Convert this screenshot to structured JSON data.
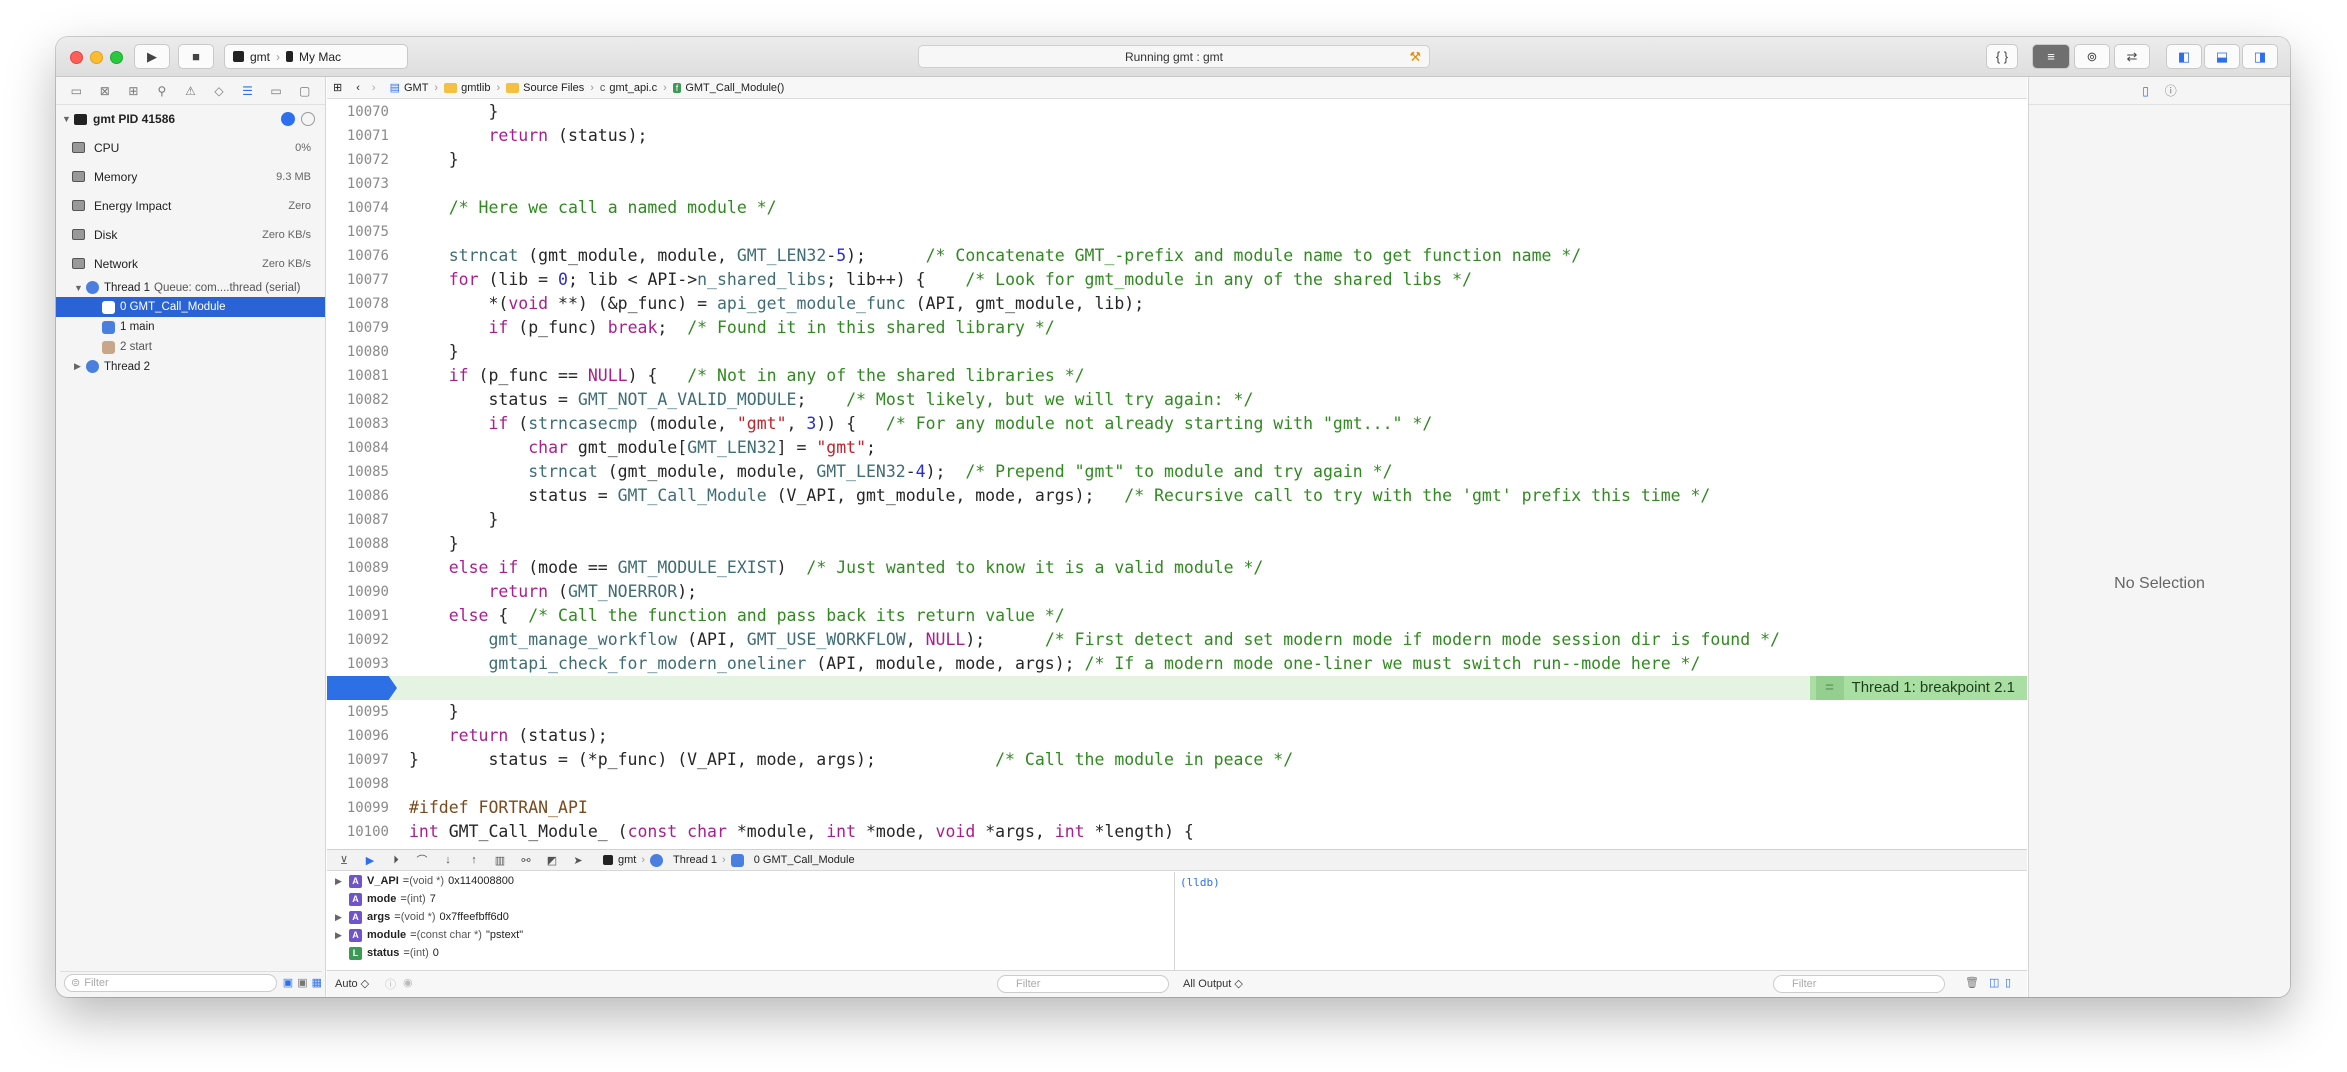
{
  "titlebar": {
    "scheme_target": "gmt",
    "scheme_device": "My Mac",
    "activity_status": "Running gmt : gmt"
  },
  "navigator": {
    "process_label": "gmt PID 41586",
    "gauges": [
      {
        "label": "CPU",
        "value": "0%"
      },
      {
        "label": "Memory",
        "value": "9.3 MB"
      },
      {
        "label": "Energy Impact",
        "value": "Zero"
      },
      {
        "label": "Disk",
        "value": "Zero KB/s"
      },
      {
        "label": "Network",
        "value": "Zero KB/s"
      }
    ],
    "thread1": "Thread 1",
    "thread1_queue": "Queue: com....thread (serial)",
    "frames": [
      "0 GMT_Call_Module",
      "1 main",
      "2 start"
    ],
    "thread2": "Thread 2",
    "filter_placeholder": "Filter"
  },
  "jumpbar": {
    "items": [
      "GMT",
      "gmtlib",
      "Source Files",
      "gmt_api.c",
      "GMT_Call_Module()"
    ]
  },
  "editor": {
    "breakpoint_label": "Thread 1: breakpoint 2.1",
    "current_line": 10094
  },
  "debugbar": {
    "crumbs": [
      "gmt",
      "Thread 1",
      "0 GMT_Call_Module"
    ]
  },
  "variables": [
    {
      "name": "V_API",
      "type": "(void *)",
      "value": "0x114008800",
      "expandable": true,
      "badge": "A"
    },
    {
      "name": "mode",
      "type": "(int)",
      "value": "7",
      "expandable": false,
      "badge": "A"
    },
    {
      "name": "args",
      "type": "(void *)",
      "value": "0x7ffeefbff6d0",
      "expandable": true,
      "badge": "A"
    },
    {
      "name": "module",
      "type": "(const char *)",
      "value": "\"pstext\"",
      "expandable": true,
      "badge": "A"
    },
    {
      "name": "status",
      "type": "(int)",
      "value": "0",
      "expandable": false,
      "badge": "L"
    }
  ],
  "console": {
    "prompt": "(lldb)"
  },
  "bottombar": {
    "auto_label": "Auto ◇",
    "filter_placeholder": "Filter",
    "output_label": "All Output ◇",
    "console_filter_placeholder": "Filter"
  },
  "inspector": {
    "empty_label": "No Selection"
  },
  "colors": {
    "accent": "#2d6fe5",
    "current_line_bg": "#e4f3e2",
    "breakpoint_label_bg": "#a9dfa3",
    "keyword": "#aa1d92",
    "comment": "#2f8a1f",
    "string": "#c4232a"
  }
}
